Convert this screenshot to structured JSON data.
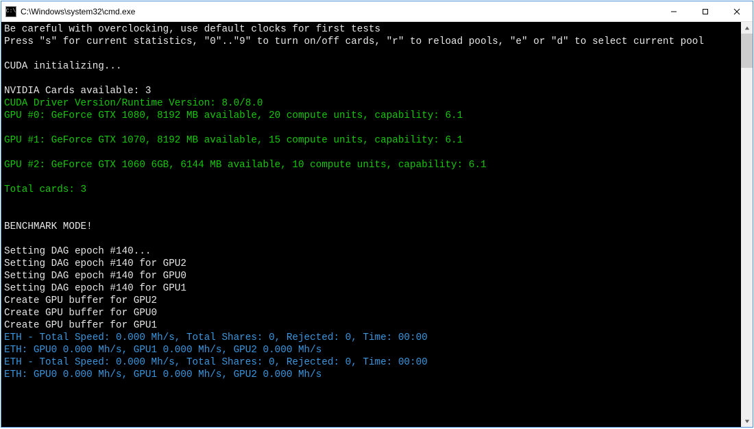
{
  "window": {
    "title": "C:\\Windows\\system32\\cmd.exe",
    "icon_label": "C:\\"
  },
  "controls": {
    "minimize": "—",
    "maximize": "▢",
    "close": "✕"
  },
  "lines": [
    {
      "cls": "w",
      "text": "Be careful with overclocking, use default clocks for first tests"
    },
    {
      "cls": "w",
      "text": "Press \"s\" for current statistics, \"0\"..\"9\" to turn on/off cards, \"r\" to reload pools, \"e\" or \"d\" to select current pool"
    },
    {
      "cls": "w",
      "text": ""
    },
    {
      "cls": "w",
      "text": "CUDA initializing..."
    },
    {
      "cls": "w",
      "text": ""
    },
    {
      "cls": "w",
      "text": "NVIDIA Cards available: 3"
    },
    {
      "cls": "g",
      "text": "CUDA Driver Version/Runtime Version: 8.0/8.0"
    },
    {
      "cls": "g",
      "text": "GPU #0: GeForce GTX 1080, 8192 MB available, 20 compute units, capability: 6.1"
    },
    {
      "cls": "g",
      "text": ""
    },
    {
      "cls": "g",
      "text": "GPU #1: GeForce GTX 1070, 8192 MB available, 15 compute units, capability: 6.1"
    },
    {
      "cls": "g",
      "text": ""
    },
    {
      "cls": "g",
      "text": "GPU #2: GeForce GTX 1060 6GB, 6144 MB available, 10 compute units, capability: 6.1"
    },
    {
      "cls": "g",
      "text": ""
    },
    {
      "cls": "g",
      "text": "Total cards: 3"
    },
    {
      "cls": "w",
      "text": ""
    },
    {
      "cls": "w",
      "text": ""
    },
    {
      "cls": "w",
      "text": "BENCHMARK MODE!"
    },
    {
      "cls": "w",
      "text": ""
    },
    {
      "cls": "w",
      "text": "Setting DAG epoch #140..."
    },
    {
      "cls": "w",
      "text": "Setting DAG epoch #140 for GPU2"
    },
    {
      "cls": "w",
      "text": "Setting DAG epoch #140 for GPU0"
    },
    {
      "cls": "w",
      "text": "Setting DAG epoch #140 for GPU1"
    },
    {
      "cls": "w",
      "text": "Create GPU buffer for GPU2"
    },
    {
      "cls": "w",
      "text": "Create GPU buffer for GPU0"
    },
    {
      "cls": "w",
      "text": "Create GPU buffer for GPU1"
    },
    {
      "cls": "c",
      "text": "ETH - Total Speed: 0.000 Mh/s, Total Shares: 0, Rejected: 0, Time: 00:00"
    },
    {
      "cls": "c",
      "text": "ETH: GPU0 0.000 Mh/s, GPU1 0.000 Mh/s, GPU2 0.000 Mh/s"
    },
    {
      "cls": "c",
      "text": "ETH - Total Speed: 0.000 Mh/s, Total Shares: 0, Rejected: 0, Time: 00:00"
    },
    {
      "cls": "c",
      "text": "ETH: GPU0 0.000 Mh/s, GPU1 0.000 Mh/s, GPU2 0.000 Mh/s"
    }
  ]
}
